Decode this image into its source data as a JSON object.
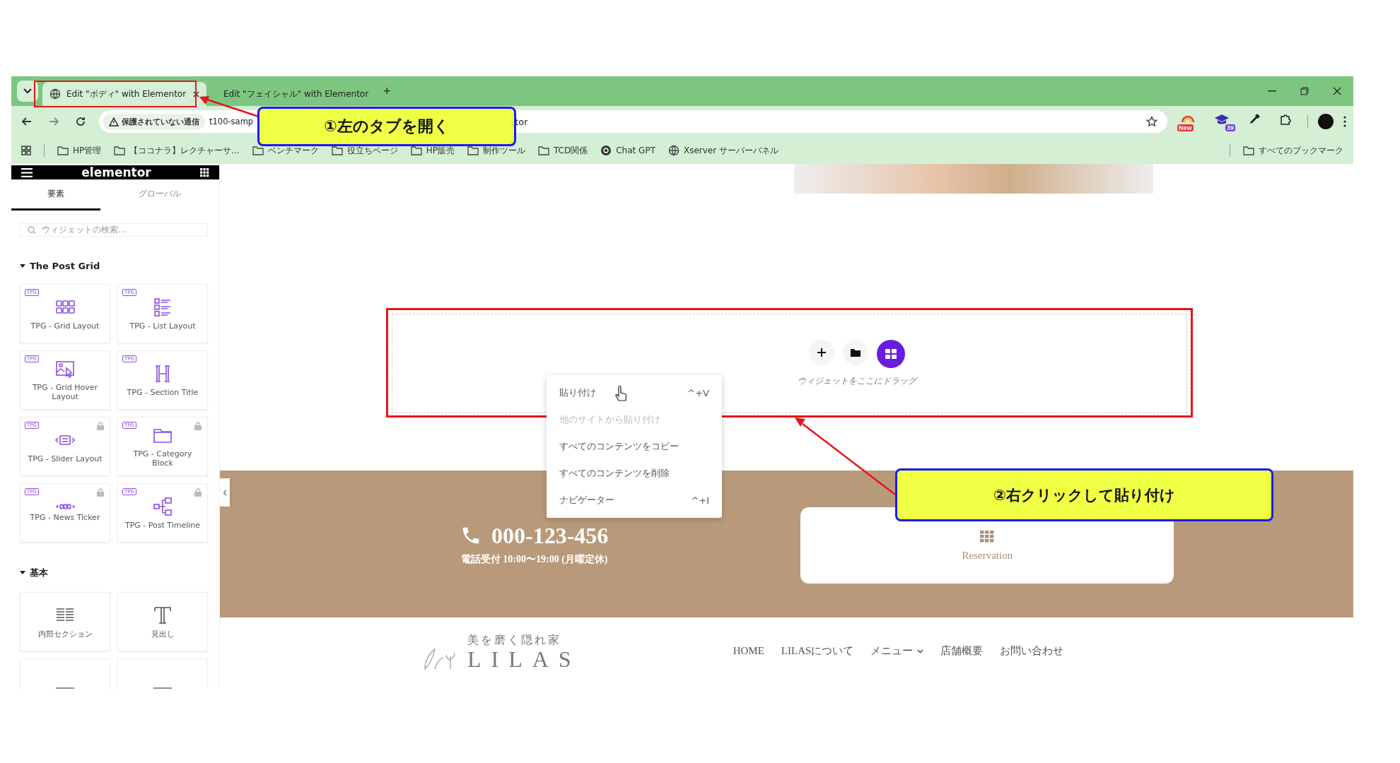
{
  "browser": {
    "tabs": [
      {
        "title": "Edit \"ボディ\" with Elementor",
        "selected": true
      },
      {
        "title": "Edit \"フェイシャル\" with Elementor",
        "selected": false
      }
    ],
    "new_tab": "+",
    "address": {
      "warning": "保護されていない通信",
      "url_start": "t100-samp",
      "url_end": "tor"
    },
    "extensions": [
      {
        "kind": "new",
        "badge": "New"
      },
      {
        "kind": "cap",
        "badge": "39"
      },
      {
        "kind": "dropper"
      },
      {
        "kind": "puzzle"
      }
    ],
    "bookmarks": [
      {
        "kind": "folder",
        "label": "HP管理"
      },
      {
        "kind": "folder",
        "label": "【ココナラ】レクチャーサ..."
      },
      {
        "kind": "folder",
        "label": "ベンチマーク"
      },
      {
        "kind": "folder",
        "label": "役立ちページ"
      },
      {
        "kind": "folder",
        "label": "HP販売"
      },
      {
        "kind": "folder",
        "label": "制作ツール"
      },
      {
        "kind": "folder",
        "label": "TCD関係"
      },
      {
        "kind": "site",
        "label": "Chat GPT"
      },
      {
        "kind": "globe",
        "label": "Xserver サーバーパネル"
      }
    ],
    "all_bookmarks": "すべてのブックマーク"
  },
  "sidebar": {
    "logo": "elementor",
    "tabs": [
      {
        "label": "要素",
        "selected": true
      },
      {
        "label": "グローバル",
        "selected": false
      }
    ],
    "search": {
      "placeholder": "ウィジェットの検索..."
    },
    "categories": [
      {
        "title": "The Post Grid",
        "expanded": true,
        "widgets": [
          {
            "kind": "grid",
            "badge": "TPG",
            "label": "TPG - Grid Layout",
            "locked": false
          },
          {
            "kind": "list",
            "badge": "TPG",
            "label": "TPG - List Layout",
            "locked": false
          },
          {
            "kind": "hover",
            "badge": "TPG",
            "label": "TPG - Grid Hover Layout",
            "locked": false
          },
          {
            "kind": "heading",
            "badge": "TPG",
            "label": "TPG - Section Title",
            "locked": false
          },
          {
            "kind": "slider",
            "badge": "TPG",
            "label": "TPG - Slider Layout",
            "locked": true
          },
          {
            "kind": "folder",
            "badge": "TPG",
            "label": "TPG - Category Block",
            "locked": true
          },
          {
            "kind": "ticker",
            "badge": "TPG",
            "label": "TPG - News Ticker",
            "locked": true
          },
          {
            "kind": "timeline",
            "badge": "TPG",
            "label": "TPG - Post Timeline",
            "locked": true
          }
        ]
      },
      {
        "title": "基本",
        "expanded": true,
        "widgets": [
          {
            "kind": "section",
            "label": "内部セクション"
          },
          {
            "kind": "text",
            "label": "見出し"
          },
          {
            "kind": "rule"
          },
          {
            "kind": "rule"
          }
        ]
      }
    ]
  },
  "canvas": {
    "drop_zone": {
      "hint": "ウィジェットをここにドラッグ"
    },
    "context_menu": [
      {
        "label": "貼り付け",
        "shortcut": "^+V",
        "disabled": false
      },
      {
        "label": "他のサイトから貼り付け",
        "disabled": true
      },
      {
        "label": "すべてのコンテンツをコピー",
        "disabled": false
      },
      {
        "label": "すべてのコンテンツを削除",
        "disabled": false
      },
      {
        "label": "ナビゲーター",
        "shortcut": "^+I",
        "disabled": false
      }
    ],
    "contact": {
      "phone": "000-123-456",
      "hours": "電話受付 10:00〜19:00 (月曜定休)",
      "reservation": "Reservation"
    },
    "footer": {
      "tagline": "美を磨く隠れ家",
      "logo": "LILAS",
      "nav": [
        {
          "label": "HOME",
          "dropdown": false
        },
        {
          "label": "LILASについて",
          "dropdown": false
        },
        {
          "label": "メニュー",
          "dropdown": true
        },
        {
          "label": "店舗概要",
          "dropdown": false
        },
        {
          "label": "お問い合わせ",
          "dropdown": false
        }
      ]
    }
  },
  "annotations": [
    {
      "text": "①左のタブを開く"
    },
    {
      "text": "②右クリックして貼り付け"
    }
  ]
}
